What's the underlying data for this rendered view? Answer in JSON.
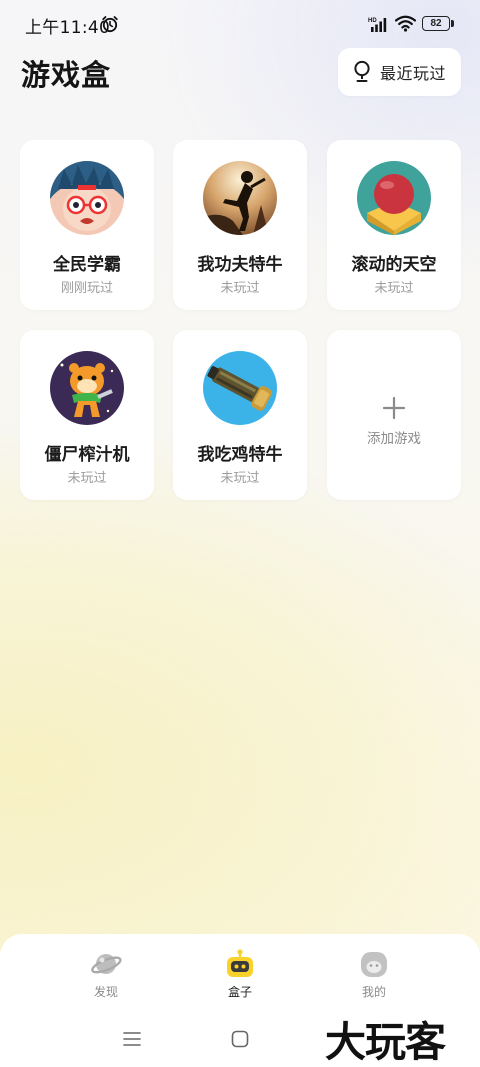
{
  "status_bar": {
    "time": "上午11:40",
    "battery": "82"
  },
  "header": {
    "title": "游戏盒",
    "recent_button_label": "最近玩过"
  },
  "games": [
    {
      "name": "全民学霸",
      "status": "刚刚玩过",
      "icon": "cartoon-boy-glasses-icon"
    },
    {
      "name": "我功夫特牛",
      "status": "未玩过",
      "icon": "kungfu-silhouette-icon"
    },
    {
      "name": "滚动的天空",
      "status": "未玩过",
      "icon": "red-ball-icon"
    },
    {
      "name": "僵尸榨汁机",
      "status": "未玩过",
      "icon": "tiger-zombie-icon"
    },
    {
      "name": "我吃鸡特牛",
      "status": "未玩过",
      "icon": "gatling-gun-icon"
    }
  ],
  "add_game": {
    "label": "添加游戏",
    "icon": "plus-icon"
  },
  "bottom_nav": {
    "items": [
      {
        "label": "发现",
        "icon": "planet-icon",
        "active": false
      },
      {
        "label": "盒子",
        "icon": "robot-box-icon",
        "active": true
      },
      {
        "label": "我的",
        "icon": "profile-face-icon",
        "active": false
      }
    ]
  },
  "watermark": "大玩客",
  "colors": {
    "accent_yellow": "#f8d22a",
    "card_bg": "#ffffff",
    "muted_text": "#9c9c9c"
  }
}
